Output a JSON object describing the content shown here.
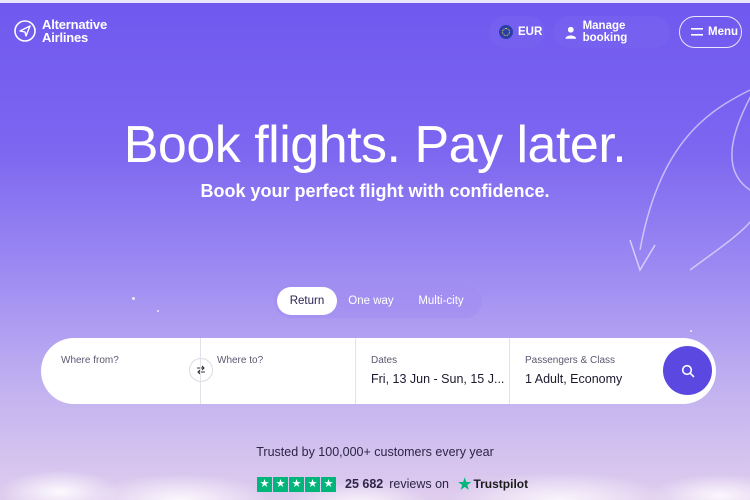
{
  "brand": {
    "name_line1": "Alternative",
    "name_line2": "Airlines"
  },
  "header": {
    "currency_label": "EUR",
    "manage_booking_label": "Manage booking",
    "menu_label": "Menu"
  },
  "hero": {
    "headline": "Book flights. Pay later.",
    "subline": "Book your perfect flight with confidence."
  },
  "trip_types": {
    "items": [
      "Return",
      "One way",
      "Multi-city"
    ],
    "selected": "Return"
  },
  "search": {
    "from_label": "Where from?",
    "from_value": "",
    "swap_icon": "swap-arrows-icon",
    "to_label": "Where to?",
    "to_value": "",
    "dates_label": "Dates",
    "dates_value": "Fri, 13 Jun - Sun, 15 J...",
    "pax_label": "Passengers & Class",
    "pax_value": "1 Adult, Economy",
    "search_icon": "search-icon"
  },
  "trust": {
    "headline": "Trusted by 100,000+ customers every year",
    "reviews_count": "25 682",
    "reviews_on": "reviews on",
    "provider": "Trustpilot",
    "stars": 5
  },
  "colors": {
    "accent": "#5b48e0",
    "background_top": "#6f58ef",
    "trustpilot_green": "#00b67a"
  }
}
